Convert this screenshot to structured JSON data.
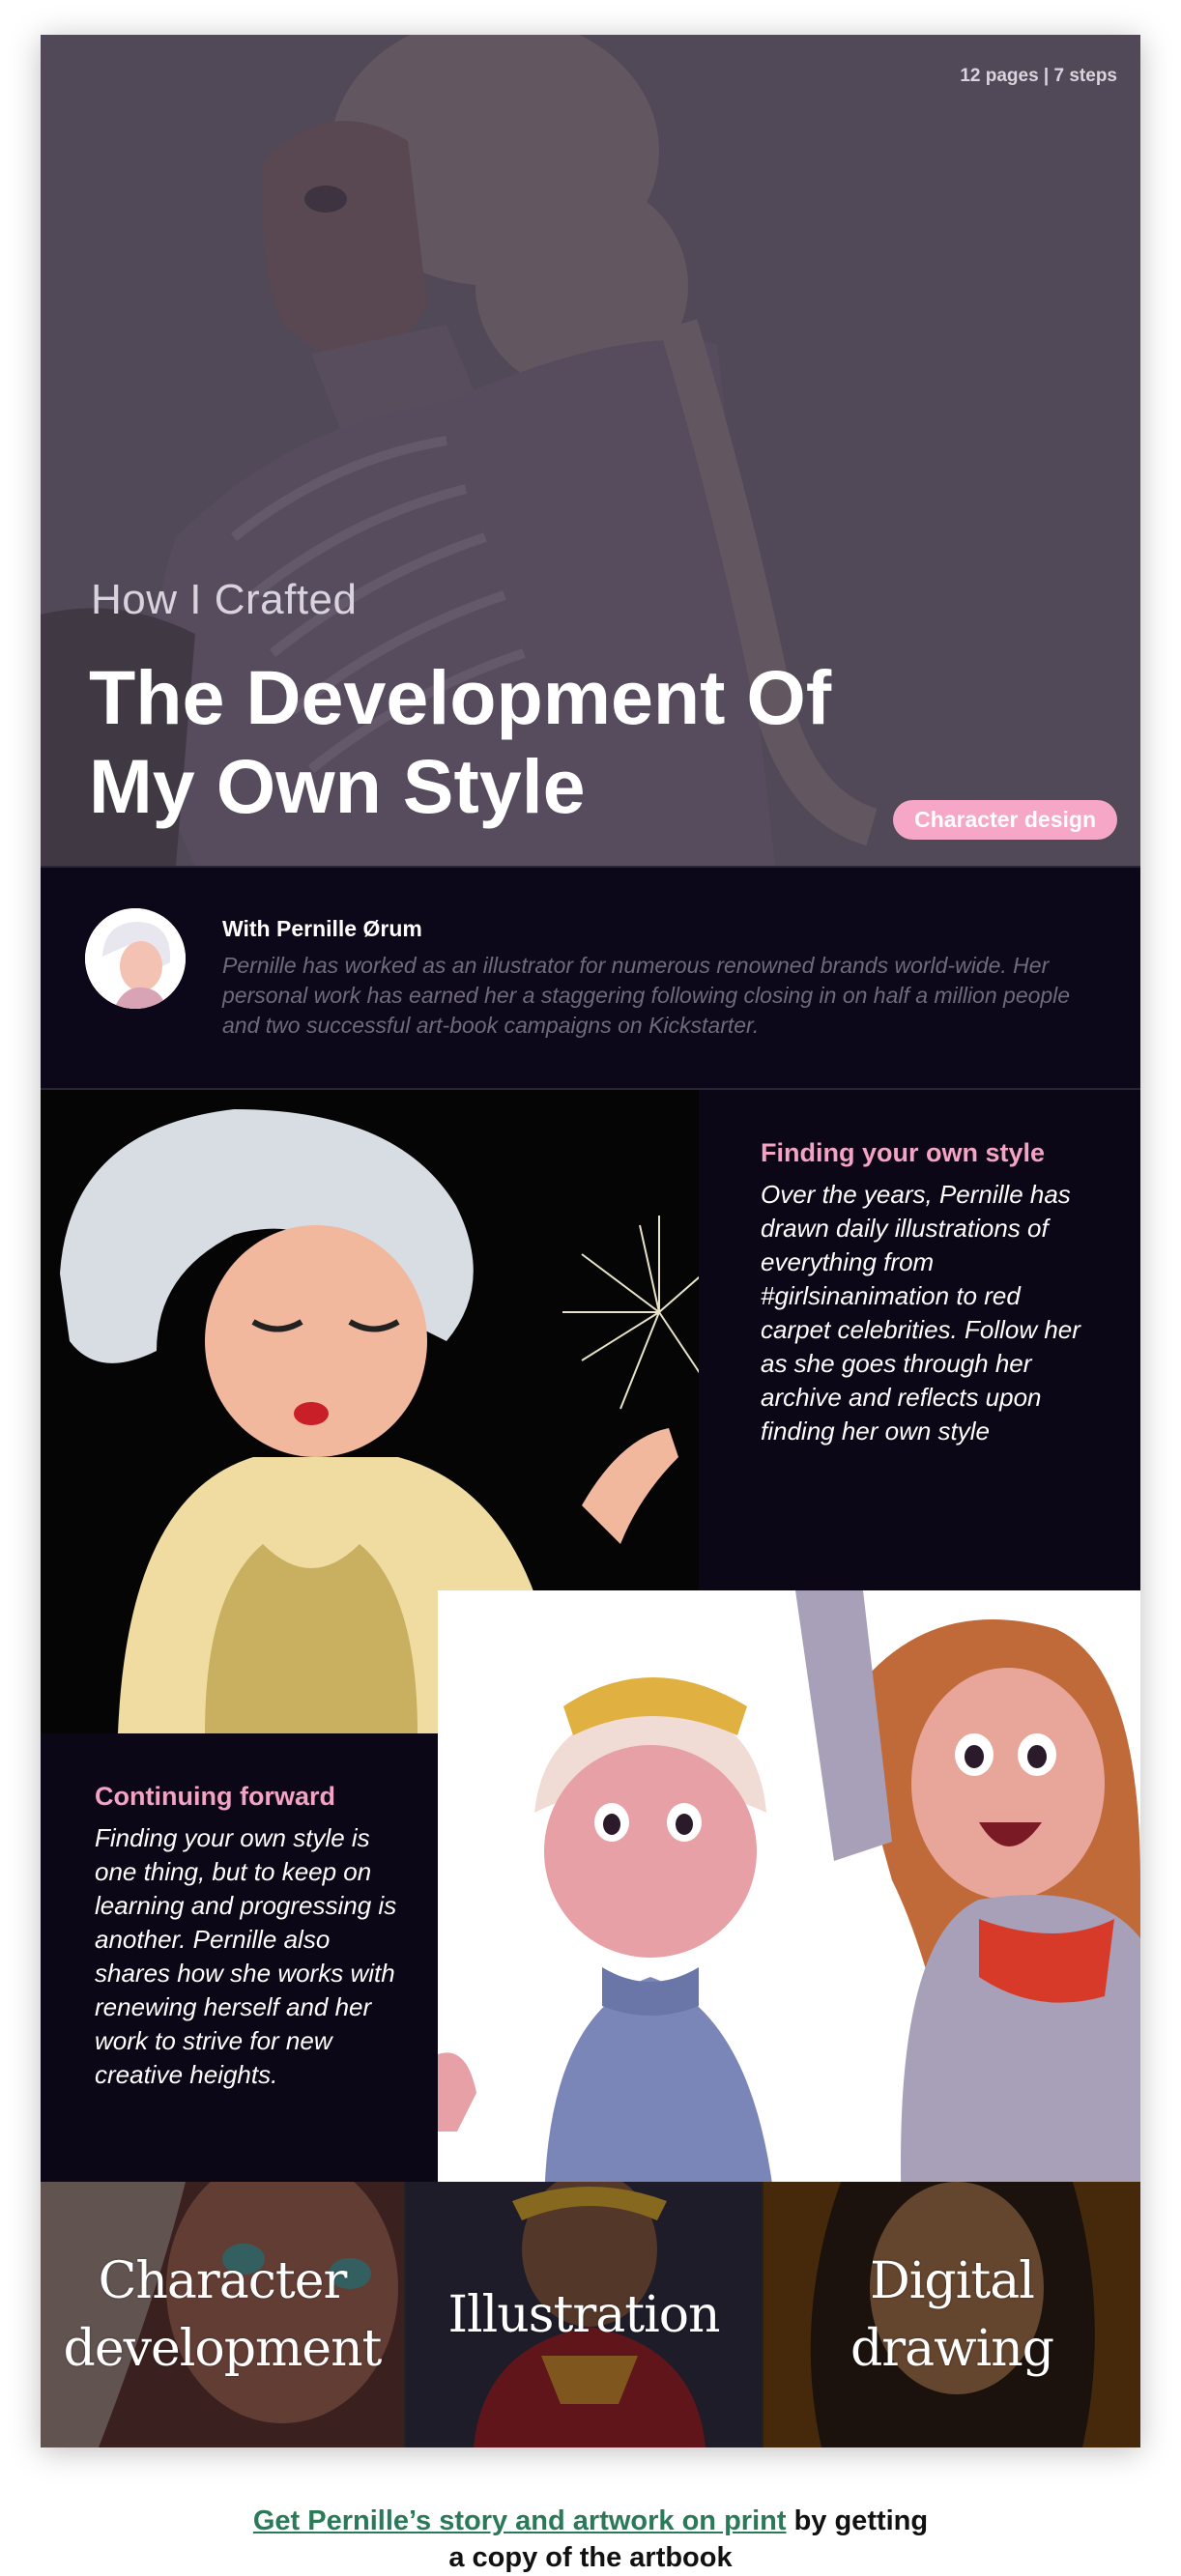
{
  "hero": {
    "meta": "12 pages | 7 steps",
    "eyebrow": "How I  Crafted",
    "title_line1": "The Development Of",
    "title_line2": "My Own Style",
    "tag": "Character design"
  },
  "author": {
    "name": "With Pernille Ørum",
    "bio": "Pernille has worked as an illustrator for numerous renowned brands world-wide. Her personal work has earned her a staggering following closing in on half a million people and two successful art-book campaigns on Kickstarter."
  },
  "features": [
    {
      "heading": "Finding your own style",
      "body": "Over the years, Pernille has drawn daily illustrations of everything from #girlsinanimation to red carpet celebrities. Follow her as she goes through her archive and reflects upon finding her own style"
    },
    {
      "heading": "Continuing forward",
      "body": "Finding your own style is one thing, but to keep on learning and progressing is another. Pernille also shares how she works with renewing herself and her work to strive for new creative heights."
    }
  ],
  "categories": [
    {
      "label": "Character\ndevelopment",
      "color": "#7a3e3a"
    },
    {
      "label": "Illustration",
      "color": "#3e3a55"
    },
    {
      "label": "Digital\ndrawing",
      "color": "#8a5a1a"
    }
  ],
  "cta": {
    "link": "Get Pernille’s story and artwork on print",
    "rest_line1": " by getting",
    "rest_line2": "a copy of the artbook"
  },
  "colors": {
    "accent_pink": "#f4a3c4",
    "dark_bg": "#0b0717",
    "link_green": "#2a7a5a"
  }
}
